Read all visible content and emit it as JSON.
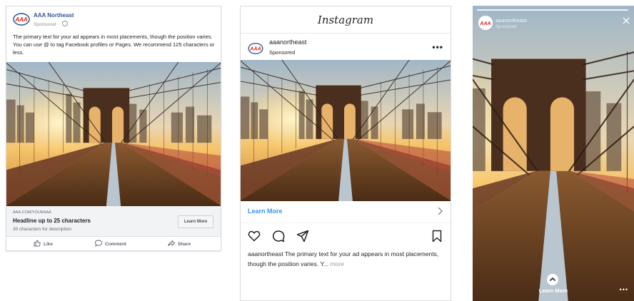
{
  "facebook_ad": {
    "page_name": "AAA Northeast",
    "sponsored": "Sponsored · ",
    "primary_text": "The primary text for your ad appears in most placements, though the position varies. You can use @ to tag Facebook profiles or Pages. We recommend 125 characters or less.",
    "domain": "AAA.COM/YOURAAA",
    "headline": "Headline up to 25 characters",
    "description": "30 characters for description",
    "cta_label": "Learn More",
    "actions": {
      "like": "Like",
      "comment": "Comment",
      "share": "Share"
    },
    "icons": {
      "logo": "aaa-logo",
      "globe": "globe-icon",
      "like": "thumbs-up-icon",
      "comment": "comment-icon",
      "share": "share-arrow-icon"
    }
  },
  "instagram_feed": {
    "wordmark": "Instagram",
    "username": "aaanortheast",
    "sponsored": "Sponsored",
    "more": "•••",
    "learn_more": "Learn More",
    "caption_user": "aaanortheast",
    "caption_text": " The primary text for your ad appears in most placements, though the position varies. Y... ",
    "caption_more": "more",
    "icons": {
      "like": "heart-icon",
      "comment": "comment-icon",
      "share": "paper-plane-icon",
      "save": "bookmark-icon",
      "chevron": "chevron-right-icon"
    },
    "accent_color": "#3897f0"
  },
  "instagram_story": {
    "username": "aaanortheast",
    "sponsored": "Sponsored",
    "learn_more": "Learn More",
    "more": "•••",
    "icons": {
      "close": "close-icon",
      "swipe_up": "chevron-up-icon"
    }
  },
  "colors": {
    "fb_link": "#385898",
    "aaa_red": "#e2231a",
    "aaa_blue": "#1f4e9c"
  }
}
